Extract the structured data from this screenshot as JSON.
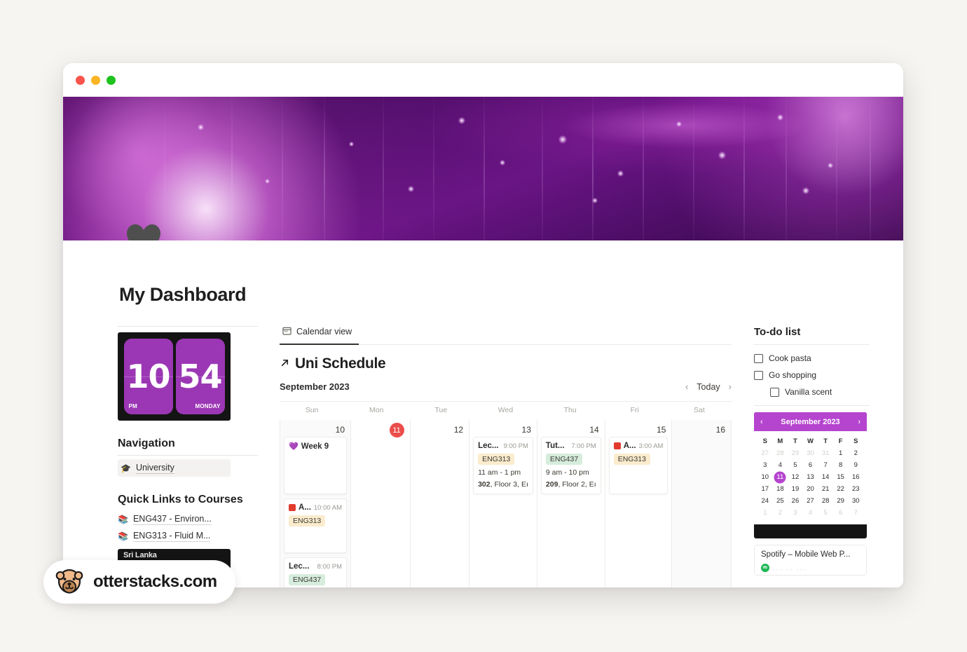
{
  "window": {
    "traffic_lights": [
      "close",
      "minimize",
      "maximize"
    ]
  },
  "banner": {
    "cover_icon": "heart-icon"
  },
  "page": {
    "title": "My Dashboard"
  },
  "clock_widget": {
    "hours": "10",
    "minutes": "54",
    "meridiem": "PM",
    "weekday": "MONDAY",
    "accent": "#9b37b5"
  },
  "sidebar": {
    "navigation_title": "Navigation",
    "nav_items": [
      {
        "icon": "graduation-cap-icon",
        "label": "University"
      }
    ],
    "quick_links_title": "Quick Links to Courses",
    "quick_links": [
      {
        "icon": "books-icon",
        "label": "ENG437 - Environ..."
      },
      {
        "icon": "books-icon",
        "label": "ENG313 - Fluid M..."
      }
    ],
    "sri_lanka_widget": {
      "label": "Sri Lanka"
    }
  },
  "main": {
    "tabs": [
      {
        "icon": "calendar-icon",
        "label": "Calendar view",
        "active": true
      }
    ],
    "schedule_title": "Uni Schedule",
    "schedule_icon": "arrow-up-right-icon",
    "calendar": {
      "month_label": "September 2023",
      "prev_label": "‹",
      "today_label": "Today",
      "next_label": "›",
      "day_names": [
        "Sun",
        "Mon",
        "Tue",
        "Wed",
        "Thu",
        "Fri",
        "Sat"
      ],
      "days": [
        {
          "num": "10",
          "weekend": true,
          "today": false,
          "events": [
            {
              "icon": "purple-heart-icon",
              "title": "Week 9",
              "time": "",
              "tag": "",
              "tag_color": "",
              "line1": "",
              "line2_bold": "",
              "line2_rest": "",
              "size": "tall"
            },
            {
              "icon": "red-square-icon",
              "title": "A...",
              "time": "10:00 AM",
              "tag": "ENG313",
              "tag_color": "amber",
              "line1": "",
              "line2_bold": "",
              "line2_rest": "",
              "size": "med"
            },
            {
              "icon": "none",
              "title": "Lec...",
              "time": "8:00 PM",
              "tag": "ENG437",
              "tag_color": "green",
              "line1": "",
              "line2_bold": "",
              "line2_rest": "",
              "size": "med"
            }
          ]
        },
        {
          "num": "11",
          "weekend": false,
          "today": true,
          "events": []
        },
        {
          "num": "12",
          "weekend": false,
          "today": false,
          "events": []
        },
        {
          "num": "13",
          "weekend": false,
          "today": false,
          "events": [
            {
              "icon": "none",
              "title": "Lec...",
              "time": "9:00 PM",
              "tag": "ENG313",
              "tag_color": "amber",
              "line1": "11 am - 1 pm",
              "line2_bold": "302",
              "line2_rest": ", Floor 3, Eı",
              "size": "tall"
            }
          ]
        },
        {
          "num": "14",
          "weekend": false,
          "today": false,
          "events": [
            {
              "icon": "none",
              "title": "Tut...",
              "time": "7:00 PM",
              "tag": "ENG437",
              "tag_color": "green",
              "line1": "9 am - 10 pm",
              "line2_bold": "209",
              "line2_rest": ", Floor 2, Eı",
              "size": "tall"
            }
          ]
        },
        {
          "num": "15",
          "weekend": false,
          "today": false,
          "events": [
            {
              "icon": "red-square-icon",
              "title": "A...",
              "time": "3:00 AM",
              "tag": "ENG313",
              "tag_color": "amber",
              "line1": "",
              "line2_bold": "",
              "line2_rest": "",
              "size": "tall"
            }
          ]
        },
        {
          "num": "16",
          "weekend": true,
          "today": false,
          "events": []
        }
      ]
    }
  },
  "todo": {
    "title": "To-do list",
    "items": [
      {
        "label": "Cook pasta",
        "checked": false,
        "nested": false
      },
      {
        "label": "Go shopping",
        "checked": false,
        "nested": false
      },
      {
        "label": "Vanilla scent",
        "checked": false,
        "nested": true
      }
    ]
  },
  "mini_calendar": {
    "month_label": "September 2023",
    "prev_icon": "chevron-left-icon",
    "next_icon": "chevron-right-icon",
    "weekday_headers": [
      "S",
      "M",
      "T",
      "W",
      "T",
      "F",
      "S"
    ],
    "selected_day": 11,
    "accent": "#b544cf",
    "weeks": [
      [
        {
          "d": "27",
          "mut": true
        },
        {
          "d": "28",
          "mut": true
        },
        {
          "d": "29",
          "mut": true
        },
        {
          "d": "30",
          "mut": true
        },
        {
          "d": "31",
          "mut": true
        },
        {
          "d": "1",
          "mut": false
        },
        {
          "d": "2",
          "mut": false
        }
      ],
      [
        {
          "d": "3",
          "mut": false
        },
        {
          "d": "4",
          "mut": false
        },
        {
          "d": "5",
          "mut": false
        },
        {
          "d": "6",
          "mut": false
        },
        {
          "d": "7",
          "mut": false
        },
        {
          "d": "8",
          "mut": false
        },
        {
          "d": "9",
          "mut": false
        }
      ],
      [
        {
          "d": "10",
          "mut": false
        },
        {
          "d": "11",
          "mut": false,
          "sel": true
        },
        {
          "d": "12",
          "mut": false
        },
        {
          "d": "13",
          "mut": false
        },
        {
          "d": "14",
          "mut": false
        },
        {
          "d": "15",
          "mut": false
        },
        {
          "d": "16",
          "mut": false
        }
      ],
      [
        {
          "d": "17",
          "mut": false
        },
        {
          "d": "18",
          "mut": false
        },
        {
          "d": "19",
          "mut": false
        },
        {
          "d": "20",
          "mut": false
        },
        {
          "d": "21",
          "mut": false
        },
        {
          "d": "22",
          "mut": false
        },
        {
          "d": "23",
          "mut": false
        }
      ],
      [
        {
          "d": "24",
          "mut": false
        },
        {
          "d": "25",
          "mut": false
        },
        {
          "d": "26",
          "mut": false
        },
        {
          "d": "27",
          "mut": false
        },
        {
          "d": "28",
          "mut": false
        },
        {
          "d": "29",
          "mut": false
        },
        {
          "d": "30",
          "mut": false
        }
      ],
      [
        {
          "d": "1",
          "mut": true
        },
        {
          "d": "2",
          "mut": true
        },
        {
          "d": "3",
          "mut": true
        },
        {
          "d": "4",
          "mut": true
        },
        {
          "d": "5",
          "mut": true
        },
        {
          "d": "6",
          "mut": true
        },
        {
          "d": "7",
          "mut": true
        }
      ]
    ]
  },
  "spotify": {
    "title": "Spotify – Mobile Web P...",
    "subtitle_blurred": "···   ··   ···",
    "icon": "spotify-icon"
  },
  "watermark": {
    "text": "otterstacks.com",
    "icon": "otter-logo-icon"
  }
}
